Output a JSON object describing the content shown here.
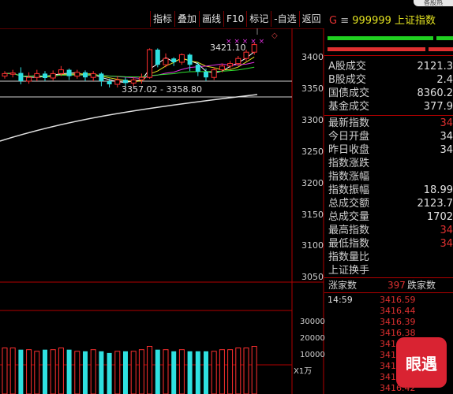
{
  "top_tab": "各股热",
  "toolbar": [
    {
      "label": "指标"
    },
    {
      "label": "叠加"
    },
    {
      "label": "画线"
    },
    {
      "label": "F10"
    },
    {
      "label": "标记"
    },
    {
      "label": "-自选"
    },
    {
      "label": "返回"
    }
  ],
  "chart": {
    "price_labels": [
      "3400",
      "3350",
      "3300",
      "3250",
      "3200",
      "3150",
      "3100",
      "3050"
    ],
    "high_marker": "3421.10",
    "range_box": "3357.02 - 3358.80",
    "volume_labels": [
      "30000",
      "20000",
      "10000"
    ],
    "volume_unit": "X1万",
    "chart_data": {
      "type": "candlestick",
      "candles": [
        {
          "o": 3368,
          "c": 3372,
          "h": 3376,
          "l": 3364,
          "up": true
        },
        {
          "o": 3371,
          "c": 3373,
          "h": 3378,
          "l": 3366,
          "up": true
        },
        {
          "o": 3373,
          "c": 3360,
          "h": 3382,
          "l": 3355,
          "up": false
        },
        {
          "o": 3360,
          "c": 3366,
          "h": 3374,
          "l": 3356,
          "up": true
        },
        {
          "o": 3366,
          "c": 3372,
          "h": 3378,
          "l": 3360,
          "up": true
        },
        {
          "o": 3372,
          "c": 3365,
          "h": 3376,
          "l": 3360,
          "up": false
        },
        {
          "o": 3365,
          "c": 3372,
          "h": 3377,
          "l": 3361,
          "up": true
        },
        {
          "o": 3372,
          "c": 3378,
          "h": 3384,
          "l": 3368,
          "up": true
        },
        {
          "o": 3378,
          "c": 3368,
          "h": 3380,
          "l": 3362,
          "up": false
        },
        {
          "o": 3368,
          "c": 3374,
          "h": 3378,
          "l": 3364,
          "up": true
        },
        {
          "o": 3374,
          "c": 3366,
          "h": 3377,
          "l": 3360,
          "up": false
        },
        {
          "o": 3366,
          "c": 3372,
          "h": 3376,
          "l": 3360,
          "up": true
        },
        {
          "o": 3372,
          "c": 3360,
          "h": 3374,
          "l": 3352,
          "up": false
        },
        {
          "o": 3360,
          "c": 3355,
          "h": 3364,
          "l": 3350,
          "up": false
        },
        {
          "o": 3355,
          "c": 3362,
          "h": 3368,
          "l": 3350,
          "up": true
        },
        {
          "o": 3362,
          "c": 3357,
          "h": 3366,
          "l": 3352,
          "up": false
        },
        {
          "o": 3357,
          "c": 3362,
          "h": 3366,
          "l": 3352,
          "up": true
        },
        {
          "o": 3362,
          "c": 3366,
          "h": 3372,
          "l": 3356,
          "up": true
        },
        {
          "o": 3366,
          "c": 3410,
          "h": 3412,
          "l": 3364,
          "up": true
        },
        {
          "o": 3410,
          "c": 3386,
          "h": 3412,
          "l": 3382,
          "up": false
        },
        {
          "o": 3386,
          "c": 3396,
          "h": 3404,
          "l": 3382,
          "up": true
        },
        {
          "o": 3396,
          "c": 3390,
          "h": 3398,
          "l": 3384,
          "up": false
        },
        {
          "o": 3390,
          "c": 3402,
          "h": 3404,
          "l": 3386,
          "up": true
        },
        {
          "o": 3402,
          "c": 3386,
          "h": 3404,
          "l": 3376,
          "up": false
        },
        {
          "o": 3386,
          "c": 3375,
          "h": 3390,
          "l": 3368,
          "up": false
        },
        {
          "o": 3375,
          "c": 3366,
          "h": 3380,
          "l": 3360,
          "up": false
        },
        {
          "o": 3366,
          "c": 3378,
          "h": 3382,
          "l": 3362,
          "up": true
        },
        {
          "o": 3378,
          "c": 3384,
          "h": 3388,
          "l": 3374,
          "up": true
        },
        {
          "o": 3384,
          "c": 3388,
          "h": 3392,
          "l": 3380,
          "up": true
        },
        {
          "o": 3388,
          "c": 3396,
          "h": 3400,
          "l": 3384,
          "up": true
        },
        {
          "o": 3396,
          "c": 3406,
          "h": 3410,
          "l": 3392,
          "up": true
        },
        {
          "o": 3406,
          "c": 3418,
          "h": 3421,
          "l": 3402,
          "up": true
        }
      ],
      "volumes": [
        14,
        14,
        13,
        13,
        12,
        13,
        13,
        14,
        13,
        12,
        12,
        13,
        12,
        11,
        12,
        12,
        12,
        13,
        15,
        13,
        13,
        12,
        13,
        12,
        12,
        12,
        12,
        13,
        13,
        14,
        14,
        15
      ]
    }
  },
  "panel": {
    "code_prefix": "G",
    "code": "999999",
    "name": "上证指数",
    "stats_a": [
      {
        "label": "A股成交",
        "value": "2121.3"
      },
      {
        "label": "B股成交",
        "value": "2.4"
      },
      {
        "label": "国债成交",
        "value": "8360.2"
      },
      {
        "label": "基金成交",
        "value": "377.9"
      }
    ],
    "stats_b": [
      {
        "label": "最新指数",
        "value": "34"
      },
      {
        "label": "今日开盘",
        "value": "34"
      },
      {
        "label": "昨日收盘",
        "value": "34"
      },
      {
        "label": "指数涨跌",
        "value": ""
      },
      {
        "label": "指数涨幅",
        "value": ""
      },
      {
        "label": "指数振幅",
        "value": "18.99"
      },
      {
        "label": "总成交额",
        "value": "2123.7"
      },
      {
        "label": "总成交量",
        "value": "1702"
      },
      {
        "label": "最高指数",
        "value": "34"
      },
      {
        "label": "最低指数",
        "value": "34"
      },
      {
        "label": "指数量比",
        "value": ""
      },
      {
        "label": "上证换手",
        "value": ""
      }
    ],
    "rise_label": "涨家数",
    "rise_count": "397",
    "fall_label": "跌家数",
    "ticks": [
      {
        "time": "14:59",
        "price": "3416.59"
      },
      {
        "time": "",
        "price": "3416.44"
      },
      {
        "time": "",
        "price": "3416.39"
      },
      {
        "time": "",
        "price": "3416.38"
      },
      {
        "time": "",
        "price": "341"
      },
      {
        "time": "",
        "price": "341"
      },
      {
        "time": "",
        "price": "341"
      },
      {
        "time": "",
        "price": "341"
      },
      {
        "time": "",
        "price": "3416.42"
      }
    ],
    "logo_text": "眼遇"
  },
  "colors": {
    "up": "#ff3030",
    "down": "#2fe0e0",
    "ma1": "#ffffff",
    "ma2": "#e0e020",
    "ma3": "#e030e0",
    "ma4": "#30e030",
    "frame": "#b00000"
  }
}
